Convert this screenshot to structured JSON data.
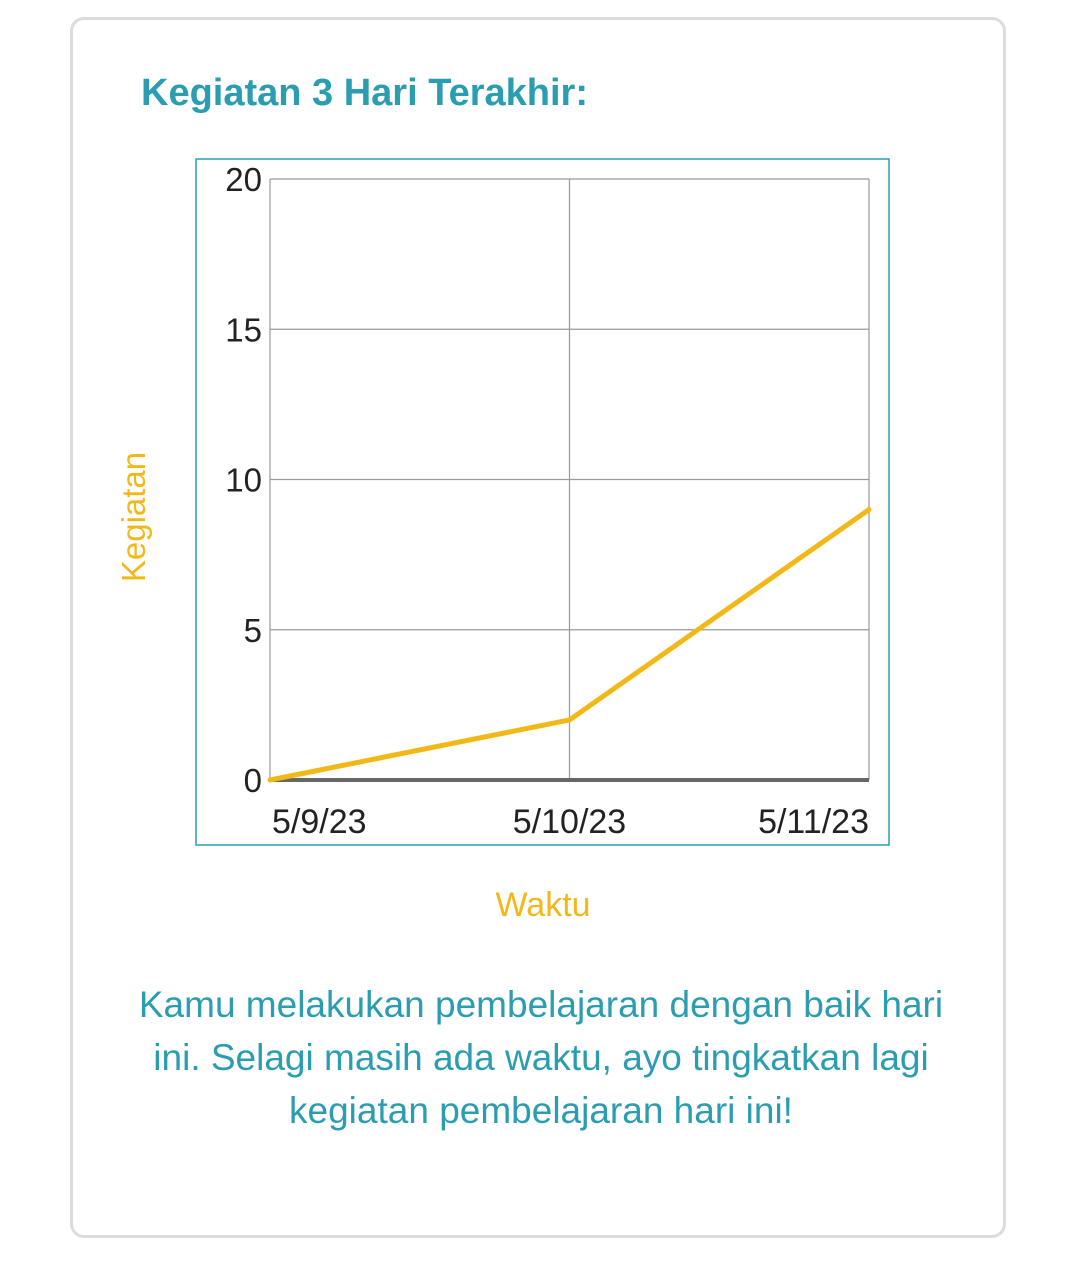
{
  "card": {
    "title": "Kegiatan 3 Hari Terakhir:",
    "message": "Kamu melakukan pembelajaran dengan baik hari ini. Selagi masih ada waktu, ayo tingkatkan lagi kegiatan pembelajaran hari ini!"
  },
  "colors": {
    "accent": "#2a9db0",
    "series": "#f2b818",
    "grid": "#9a9a9a",
    "baseline": "#666666"
  },
  "chart_data": {
    "type": "line",
    "title": "",
    "xlabel": "Waktu",
    "ylabel": "Kegiatan",
    "categories": [
      "5/9/23",
      "5/10/23",
      "5/11/23"
    ],
    "series": [
      {
        "values": [
          0,
          2,
          9
        ]
      }
    ],
    "ylim": [
      0,
      20
    ],
    "yticks": [
      "0",
      "5",
      "10",
      "15",
      "20"
    ],
    "ytick_values": [
      0,
      5,
      10,
      15,
      20
    ],
    "grid": true,
    "legend": "none"
  }
}
